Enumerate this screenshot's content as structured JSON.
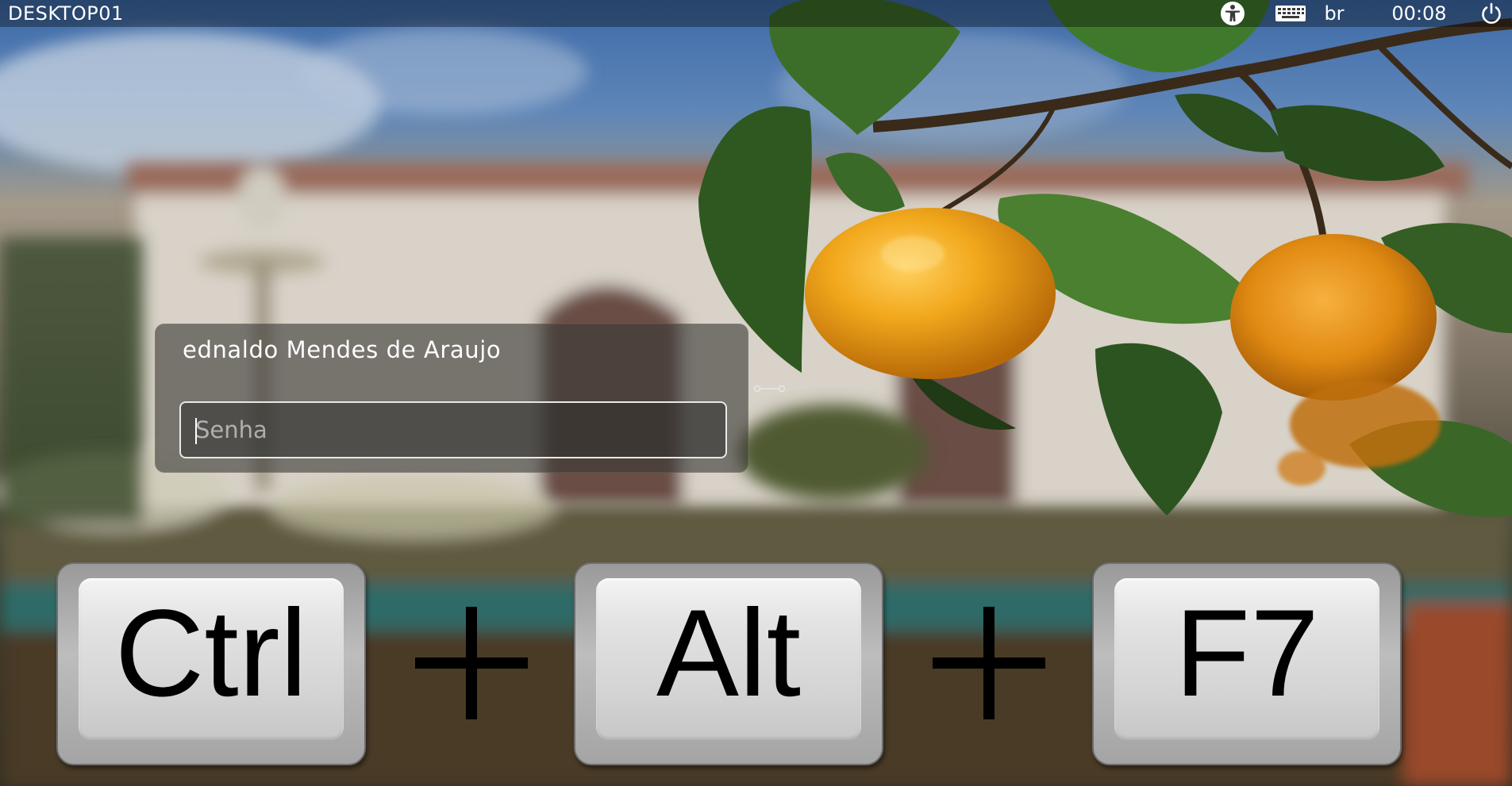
{
  "top_panel": {
    "hostname": "DESKTOP01",
    "keyboard_layout": "br",
    "clock": "00:08",
    "icons": [
      "accessibility-icon",
      "keyboard-icon",
      "power-icon"
    ]
  },
  "login": {
    "user_name": "ednaldo Mendes de Araujo",
    "password_placeholder": "Senha",
    "session_icon": "session-icon"
  },
  "shortcut": {
    "keys": [
      "Ctrl",
      "Alt",
      "F7"
    ],
    "separator_icon": "plus-icon"
  },
  "colors": {
    "panel_text": "#ffffff",
    "key_label": "#000000",
    "orange": "#f0a020"
  }
}
